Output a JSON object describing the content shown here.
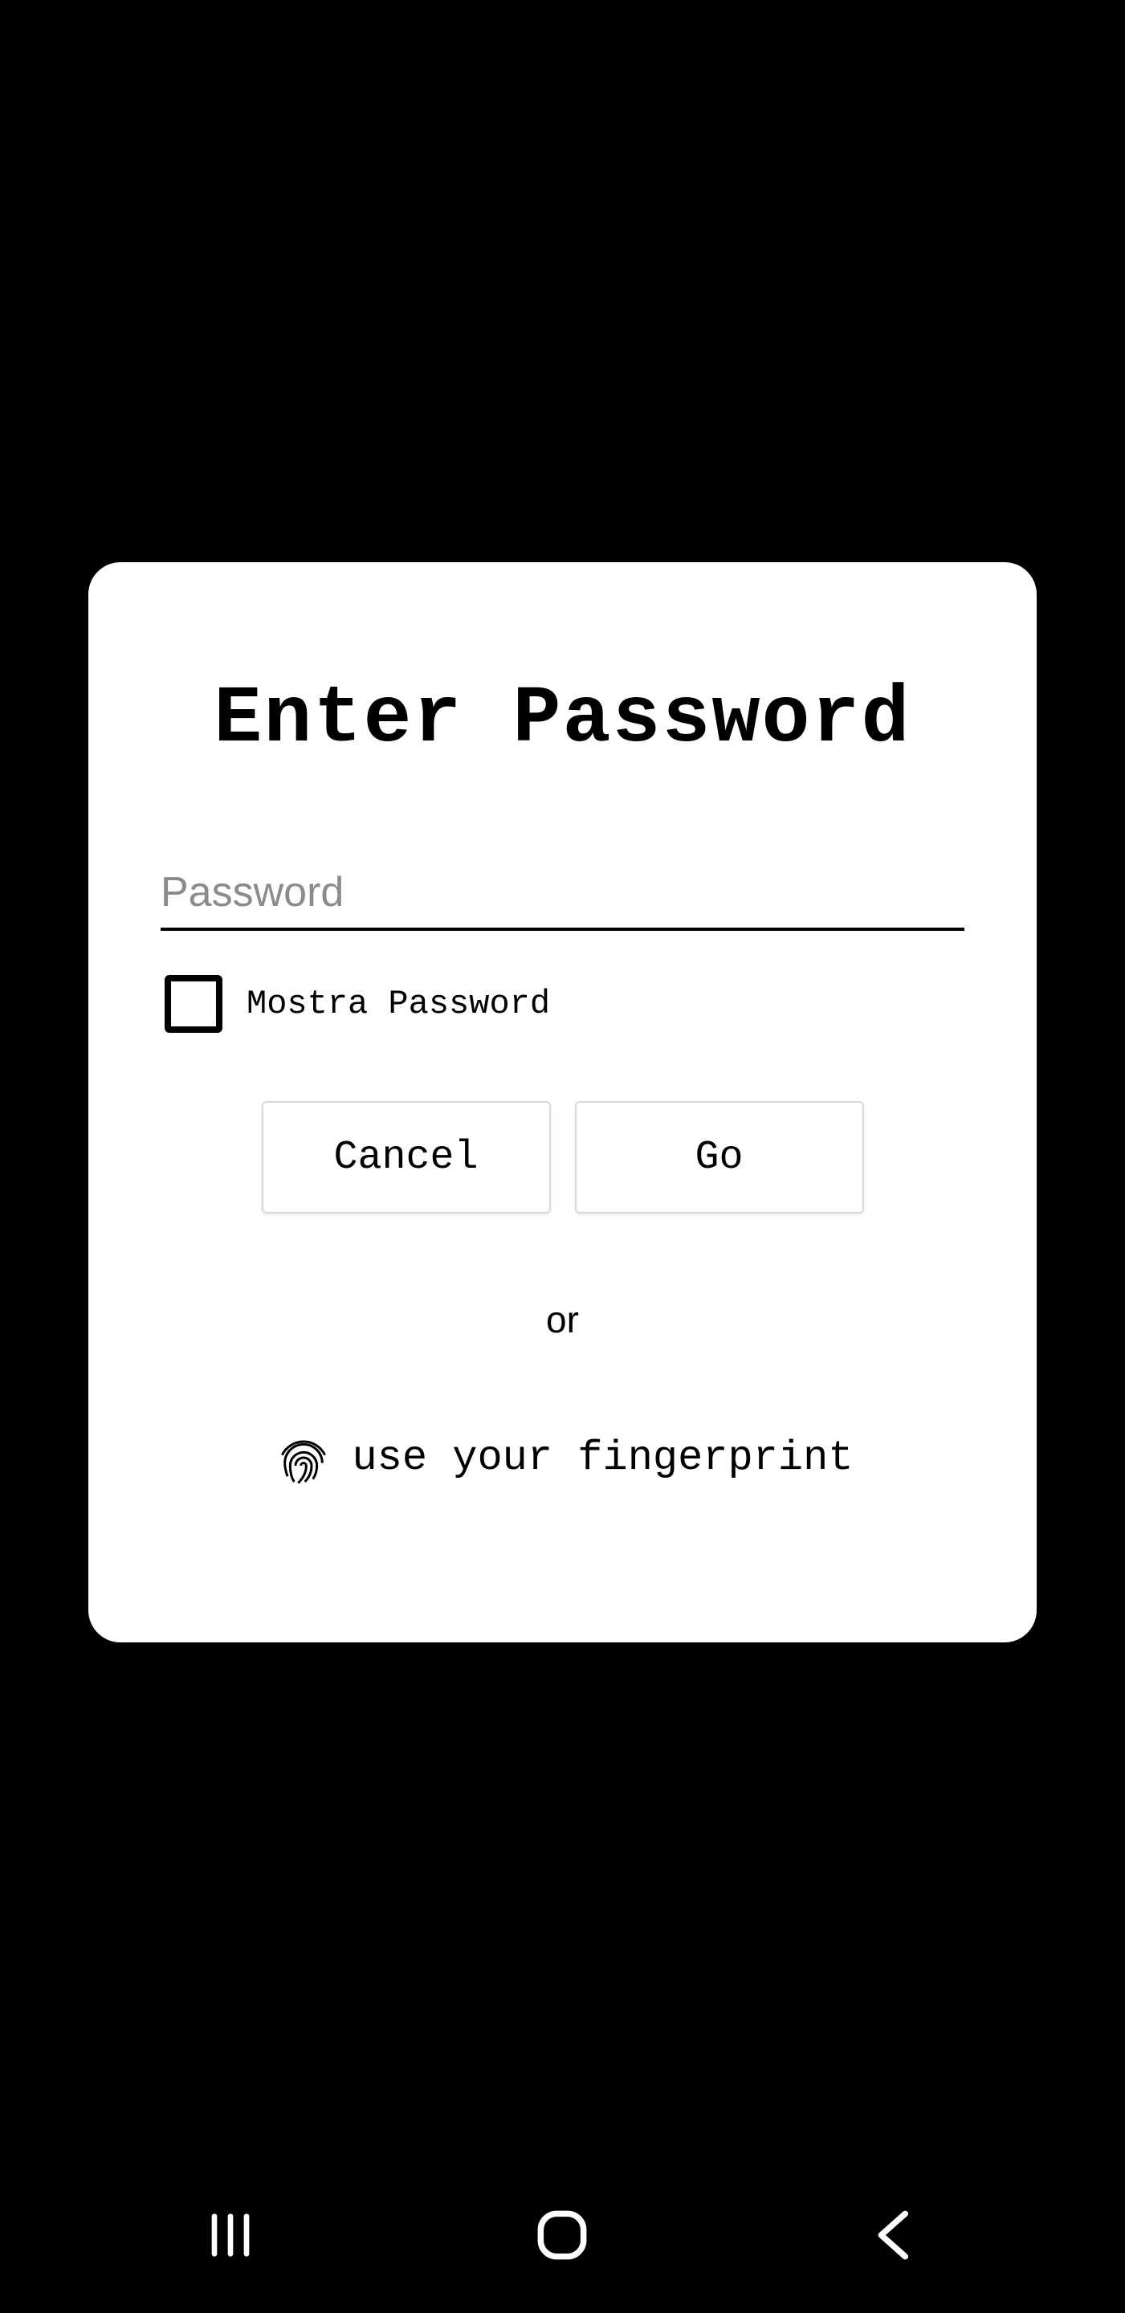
{
  "dialog": {
    "title": "Enter Password",
    "password_placeholder": "Password",
    "show_password_label": "Mostra Password",
    "cancel_label": "Cancel",
    "go_label": "Go",
    "or_text": "or",
    "fingerprint_label": "use your fingerprint"
  },
  "nav": {
    "recents": "recent-apps",
    "home": "home",
    "back": "back"
  }
}
